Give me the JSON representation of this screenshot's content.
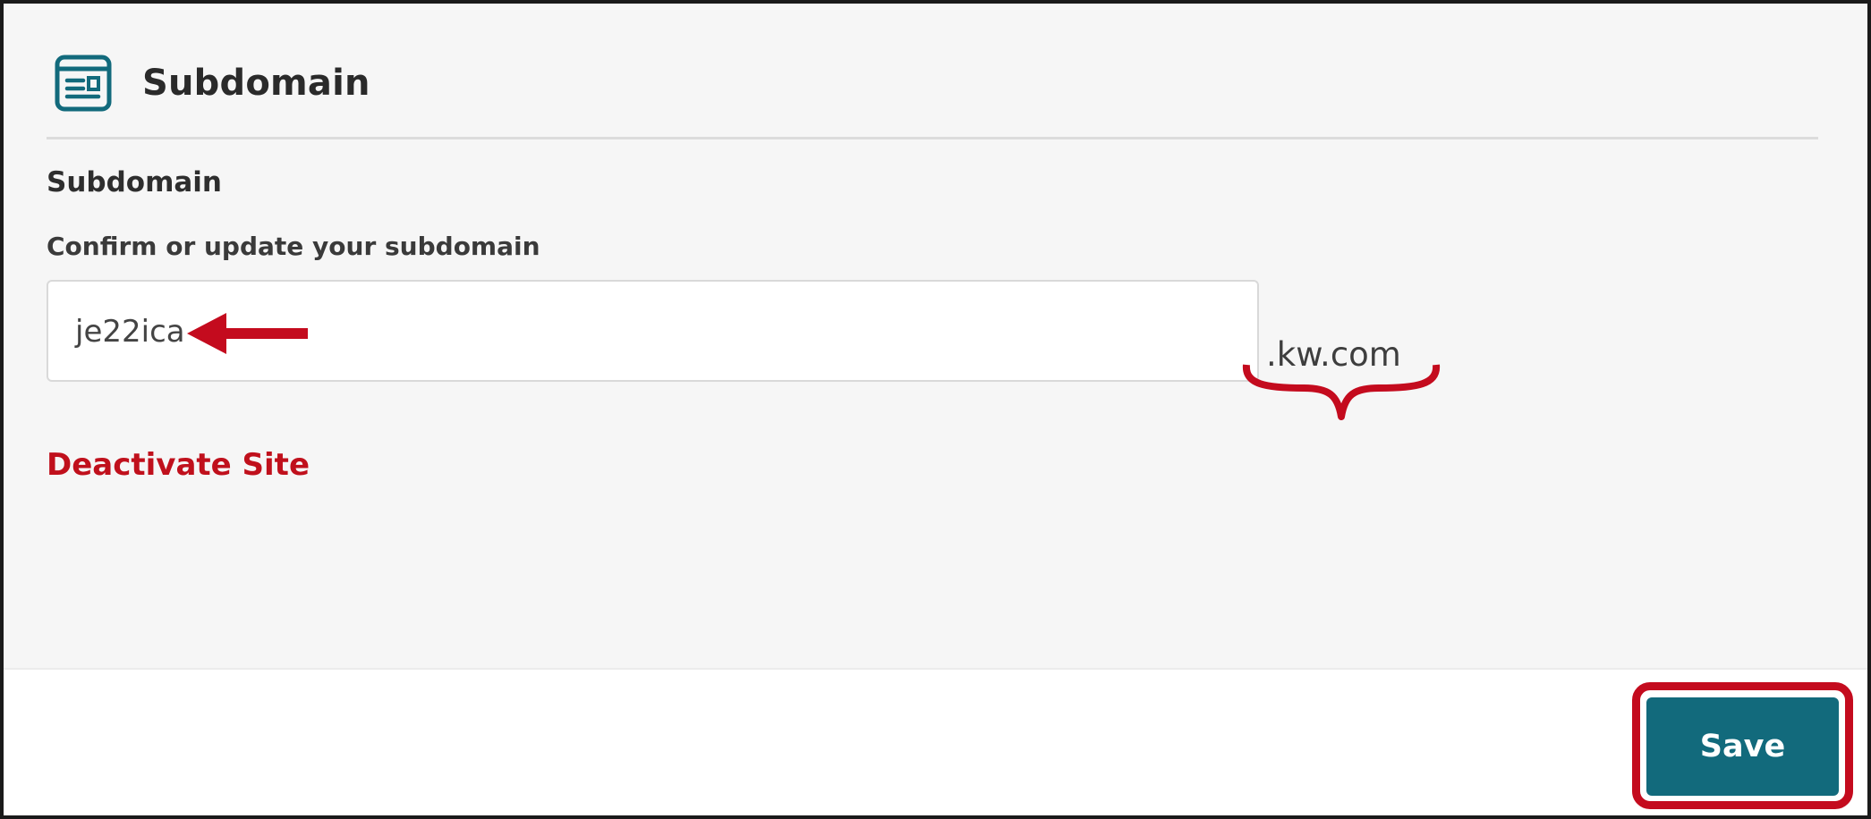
{
  "section": {
    "title": "Subdomain",
    "icon": "web-page-icon"
  },
  "field": {
    "title": "Subdomain",
    "label": "Confirm or update your subdomain",
    "value": "je22ica",
    "suffix": ".kw.com"
  },
  "actions": {
    "deactivate_label": "Deactivate Site",
    "save_label": "Save"
  },
  "annotations": {
    "value_arrow": "arrow-left-icon",
    "suffix_brace": "curly-brace-icon"
  },
  "colors": {
    "accent": "#126a7c",
    "danger": "#c0101c",
    "annotation": "#c40b1e",
    "panel_background": "#f6f6f6"
  }
}
